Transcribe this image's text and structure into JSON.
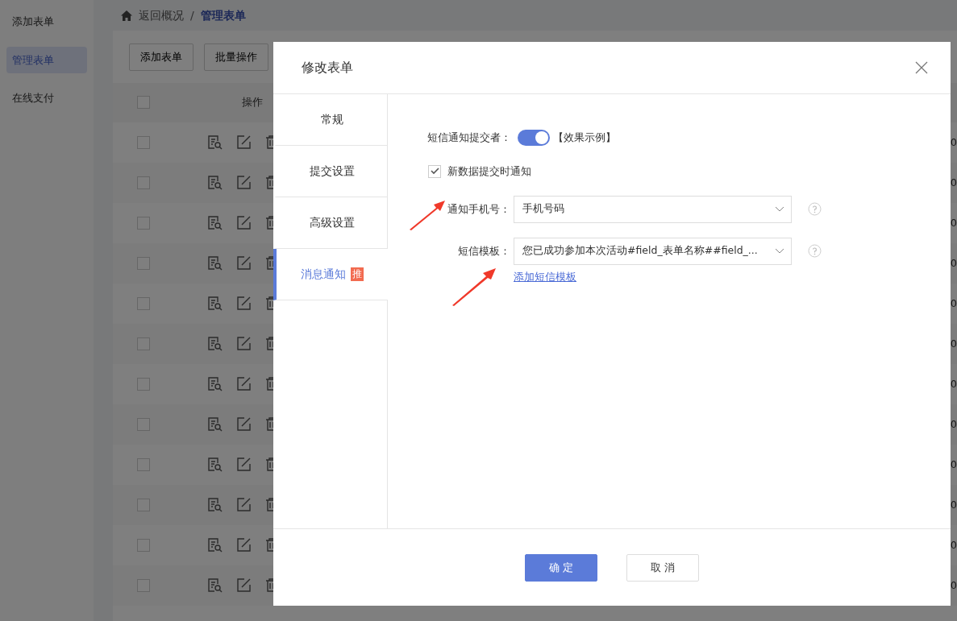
{
  "sidebar": {
    "items": [
      {
        "label": "添加表单",
        "selected": false
      },
      {
        "label": "管理表单",
        "selected": true
      },
      {
        "label": "在线支付",
        "selected": false
      }
    ]
  },
  "breadcrumb": {
    "back": "返回概况",
    "separator": "/",
    "current": "管理表单"
  },
  "toolbar": {
    "buttons": [
      "添加表单",
      "批量操作"
    ]
  },
  "table": {
    "header": {
      "checked": false,
      "column": "操作"
    },
    "rows": [
      {
        "checked": false,
        "column_3": "0"
      },
      {
        "checked": false,
        "column_3": "0"
      },
      {
        "checked": false,
        "column_3": "0"
      },
      {
        "checked": false,
        "column_3": "0"
      },
      {
        "checked": false,
        "column_3": "0"
      },
      {
        "checked": false,
        "column_3": "0"
      },
      {
        "checked": false,
        "column_3": "0"
      },
      {
        "checked": false,
        "column_3": "0"
      },
      {
        "checked": false,
        "column_3": "0"
      },
      {
        "checked": false,
        "column_3": "0"
      },
      {
        "checked": false,
        "column_3": "0"
      },
      {
        "checked": false,
        "column_3": "0"
      }
    ]
  },
  "modal": {
    "title": "修改表单",
    "tabs": [
      {
        "label": "常规",
        "selected": false
      },
      {
        "label": "提交设置",
        "selected": false
      },
      {
        "label": "高级设置",
        "selected": false
      },
      {
        "label": "消息通知",
        "selected": true,
        "badge": "推"
      }
    ],
    "form": {
      "sms_notify": {
        "label": "短信通知提交者：",
        "on": true,
        "link": "【效果示例】"
      },
      "notify_new": {
        "label": "新数据提交时通知",
        "checked": true
      },
      "phone": {
        "label": "通知手机号：",
        "value": "手机号码"
      },
      "template": {
        "label": "短信模板：",
        "value": "您已成功参加本次活动#field_表单名称##field_...",
        "link": "添加短信模板"
      }
    },
    "buttons": [
      {
        "label": "确 定",
        "kind": "primary"
      },
      {
        "label": "取 消",
        "kind": "secondary"
      }
    ]
  }
}
